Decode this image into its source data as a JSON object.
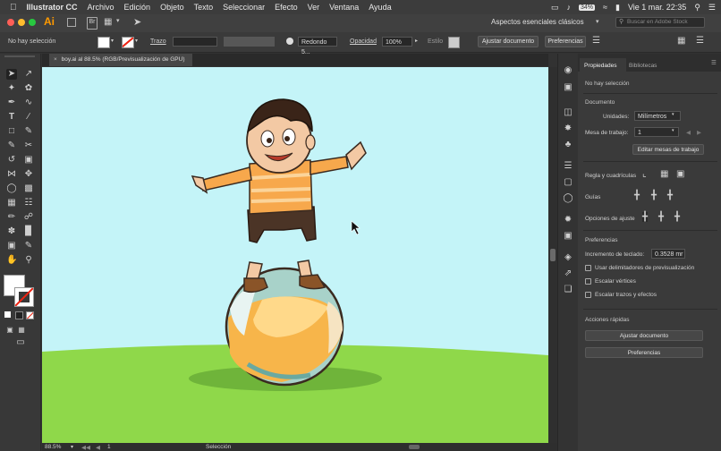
{
  "menubar": {
    "apple": "",
    "app": "Illustrator CC",
    "items": [
      "Archivo",
      "Edición",
      "Objeto",
      "Texto",
      "Seleccionar",
      "Efecto",
      "Ver",
      "Ventana",
      "Ayuda"
    ],
    "battery": "34%",
    "datetime": "Vie 1 mar.  22:35"
  },
  "appbar": {
    "logo": "Ai",
    "workspace": "Aspectos esenciales clásicos",
    "search_placeholder": "Buscar en Adobe Stock"
  },
  "controlbar": {
    "selection": "No hay selección",
    "stroke_label": "Trazo",
    "brush_value": "Redondo 5...",
    "opacity_label": "Opacidad",
    "opacity_value": "100%",
    "style_label": "Estilo",
    "fit_doc": "Ajustar documento",
    "prefs": "Preferencias"
  },
  "document": {
    "tab_title": "boy.ai al 88.5% (RGB/Previsualización de GPU)"
  },
  "status": {
    "zoom": "88.5%",
    "artboard": "1",
    "tool": "Selección"
  },
  "panel": {
    "tabs": [
      "Propiedades",
      "Bibliotecas"
    ],
    "no_selection": "No hay selección",
    "document_label": "Documento",
    "units_label": "Unidades:",
    "units_value": "Milímetros",
    "artboard_label": "Mesa de trabajo:",
    "artboard_value": "1",
    "edit_artboards": "Editar mesas de trabajo",
    "rulers_grid": "Regla y cuadrículas",
    "guides": "Guías",
    "snap_options": "Opciones de ajuste",
    "preferences_label": "Preferencias",
    "keyboard_increment_label": "Incremento de teclado:",
    "keyboard_increment_value": "0.3528 mr",
    "checkboxes": [
      "Usar delimitadores de previsualización",
      "Escalar vértices",
      "Escalar trazos y efectos"
    ],
    "quick_actions": "Acciones rápidas",
    "fit_doc": "Ajustar documento",
    "prefs": "Preferencias"
  },
  "colors": {
    "canvas_sky": "#c4f4f8",
    "grass": "#8fd84a",
    "accent": "#ff9a00"
  }
}
